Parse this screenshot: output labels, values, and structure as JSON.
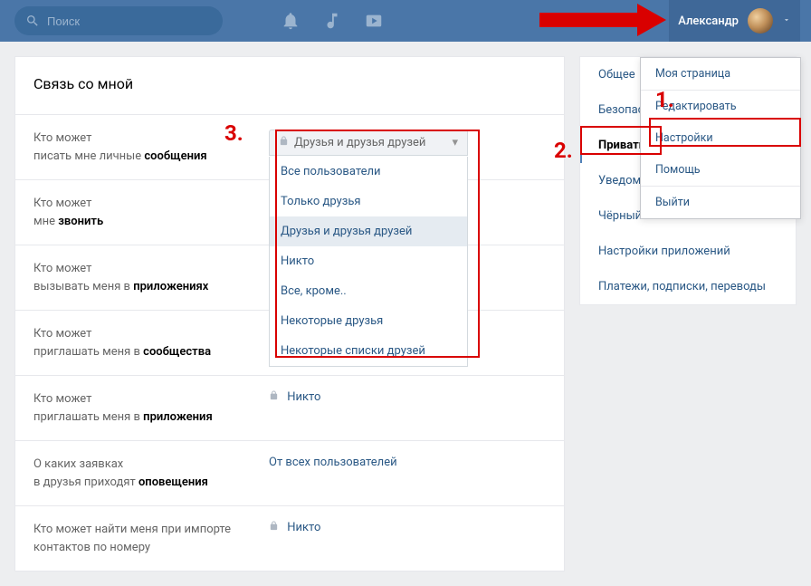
{
  "header": {
    "search_placeholder": "Поиск",
    "user_name": "Александр"
  },
  "section_title": "Связь со мной",
  "rows": [
    {
      "label_pre": "Кто может",
      "label_rest": "писать мне личные ",
      "label_bold": "сообщения"
    },
    {
      "label_pre": "Кто может",
      "label_rest": "мне ",
      "label_bold": "звонить"
    },
    {
      "label_pre": "Кто может",
      "label_rest": "вызывать меня в ",
      "label_bold": "приложениях"
    },
    {
      "label_pre": "Кто может",
      "label_rest": "приглашать меня в ",
      "label_bold": "сообщества"
    },
    {
      "label_pre": "Кто может",
      "label_rest": "приглашать меня в ",
      "label_bold": "приложения",
      "value": "Никто",
      "locked": true
    },
    {
      "label_pre": "О каких заявках",
      "label_rest": "в друзья приходят ",
      "label_bold": "оповещения",
      "value": "От всех пользователей"
    },
    {
      "label_pre": "Кто может найти меня при импорте контактов по номеру",
      "label_rest": "",
      "label_bold": "",
      "value": "Никто",
      "locked": true
    }
  ],
  "dropdown": {
    "selected": "Друзья и друзья друзей",
    "options": [
      "Все пользователи",
      "Только друзья",
      "Друзья и друзья друзей",
      "Никто",
      "Все, кроме..",
      "Некоторые друзья",
      "Некоторые списки друзей"
    ]
  },
  "sidebar": {
    "items": [
      {
        "label": "Общее"
      },
      {
        "label": "Безопасность"
      },
      {
        "label": "Приватность",
        "active": true
      },
      {
        "label": "Уведомления"
      },
      {
        "label": "Чёрный список"
      },
      {
        "label": "Настройки приложений"
      },
      {
        "label": "Платежи, подписки, переводы"
      }
    ]
  },
  "user_menu": {
    "items_top": [
      "Моя страница",
      "Редактировать",
      "Настройки",
      "Помощь"
    ],
    "items_bottom": [
      "Выйти"
    ]
  },
  "annotations": {
    "one": "1.",
    "two": "2.",
    "three": "3."
  }
}
